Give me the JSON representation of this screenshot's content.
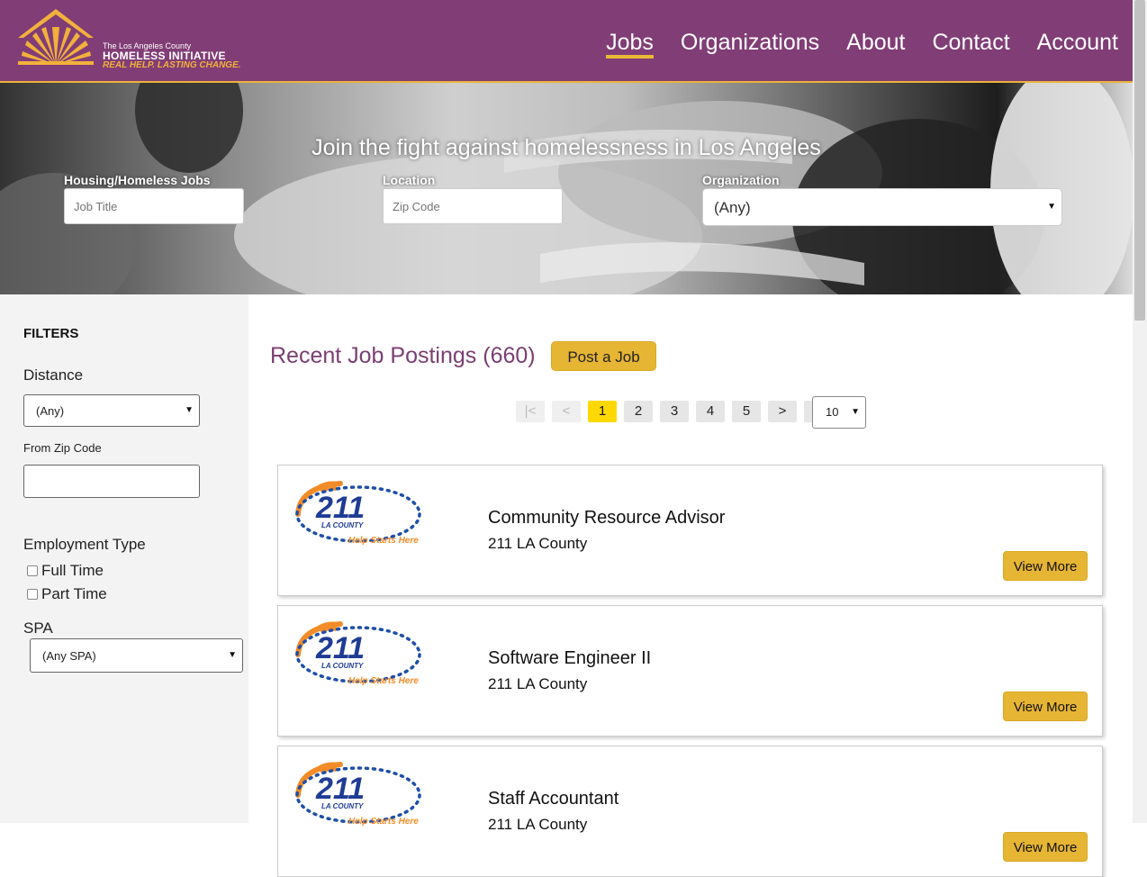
{
  "header": {
    "logo": {
      "small": "The Los Angeles County",
      "main": "HOMELESS INITIATIVE",
      "tagline": "REAL HELP. LASTING CHANGE."
    },
    "nav": [
      "Jobs",
      "Organizations",
      "About",
      "Contact",
      "Account"
    ],
    "active_nav": "Jobs"
  },
  "hero": {
    "title": "Join the fight against homelessness in Los Angeles",
    "job_label": "Housing/Homeless Jobs",
    "job_placeholder": "Job Title",
    "location_label": "Location",
    "location_placeholder": "Zip Code",
    "org_label": "Organization",
    "org_value": "(Any)"
  },
  "sidebar": {
    "heading": "FILTERS",
    "distance_label": "Distance",
    "distance_value": "(Any)",
    "zip_label": "From Zip Code",
    "employment_label": "Employment Type",
    "full_time": "Full Time",
    "part_time": "Part Time",
    "spa_label": "SPA",
    "spa_value": "(Any SPA)"
  },
  "main": {
    "title": "Recent Job Postings (660)",
    "post_button": "Post a Job",
    "pager": {
      "first": "|<",
      "prev": "<",
      "pages": [
        "1",
        "2",
        "3",
        "4",
        "5"
      ],
      "current": "1",
      "next": ">",
      "last": ">|",
      "per_page": "10"
    },
    "jobs": [
      {
        "title": "Community Resource Advisor",
        "org": "211 LA County",
        "button": "View More"
      },
      {
        "title": "Software Engineer II",
        "org": "211 LA County",
        "button": "View More"
      },
      {
        "title": "Staff Accountant",
        "org": "211 LA County",
        "button": "View More"
      }
    ],
    "logo": {
      "number": "211",
      "sub": "LA COUNTY",
      "tag": "Help Starts Here"
    }
  },
  "colors": {
    "header_bg": "#813d75",
    "accent": "#e6b533",
    "title": "#7a3f71"
  }
}
